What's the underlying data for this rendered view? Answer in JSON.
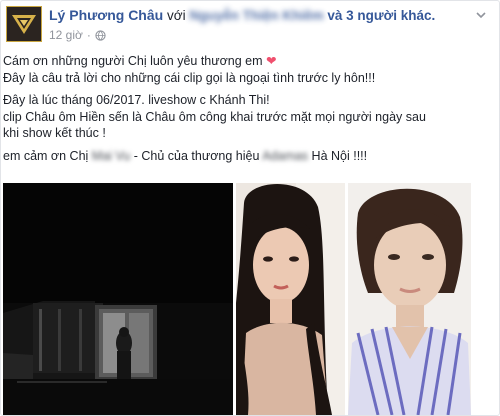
{
  "post": {
    "author": "Lý Phương Châu",
    "with_word": "với",
    "tagged_person": "Nguyễn Thiện Khiêm",
    "and_others": "và 3 người khác.",
    "timestamp": "12 giờ",
    "separator": "·",
    "privacy_icon": "globe-icon",
    "menu_icon": "chevron-down-icon"
  },
  "content": {
    "line1": "Cám ơn những người Chị luôn yêu thương em",
    "heart": "❤",
    "line2": "Đây là câu trả lời cho những cái clip gọi là ngoại tình trước ly hôn!!!",
    "line3": "Đây là lúc tháng 06/2017. liveshow c Khánh Thi!",
    "line4": "clip Châu ôm Hiền sến là Châu ôm công khai trước mặt mọi người ngày sau",
    "line5": "khi show kết thúc !",
    "line6_prefix": "em cảm ơn Chị",
    "line6_blurred_name": "Mai Vu",
    "line6_middle": "- Chủ của thương hiệu",
    "line6_blurred_brand": "Adamas",
    "line6_suffix": "Hà Nội !!!!"
  },
  "media": {
    "items": [
      "video-still",
      "photo-woman-long-hair",
      "photo-woman-striped-shirt"
    ]
  },
  "colors": {
    "link": "#365899",
    "meta": "#90949c",
    "text": "#1d2129",
    "heart": "#f0506e"
  }
}
